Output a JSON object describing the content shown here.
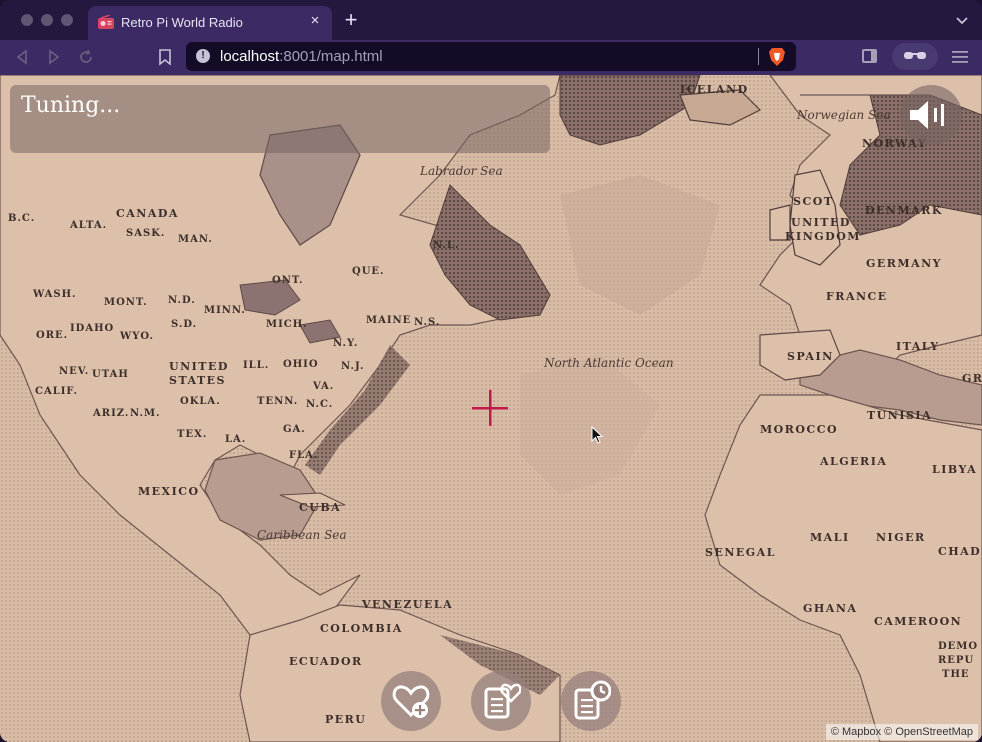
{
  "browser": {
    "tab": {
      "title": "Retro Pi World Radio",
      "favicon": "radio-icon",
      "close_glyph": "×"
    },
    "new_tab_glyph": "+",
    "url": {
      "host": "localhost",
      "rest": ":8001/map.html"
    }
  },
  "app": {
    "status": "Tuning...",
    "attribution": "© Mapbox © OpenStreetMap",
    "buttons": [
      {
        "name": "add-favorite-button",
        "icon": "heart-plus-icon"
      },
      {
        "name": "favorites-list-button",
        "icon": "heart-list-icon"
      },
      {
        "name": "history-button",
        "icon": "clock-list-icon"
      }
    ],
    "volume_icon": "speaker-icon",
    "accent_color": "#c2174b"
  },
  "map_labels": {
    "iceland": "ICELAND",
    "norwegian_sea": "Norwegian Sea",
    "labrador_sea": "Labrador Sea",
    "norway": "NORWAY",
    "scot": "SCOT",
    "denmark": "DENMARK",
    "uk1": "UNITED",
    "uk2": "KINGDOM",
    "germany": "GERMANY",
    "france": "FRANCE",
    "canada": "CANADA",
    "bc": "B.C.",
    "alta": "ALTA.",
    "sask": "SASK.",
    "man": "MAN.",
    "nl": "N.L.",
    "que": "QUE.",
    "ont": "ONT.",
    "wash": "WASH.",
    "mont": "MONT.",
    "nd": "N.D.",
    "minn": "MINN.",
    "maine": "MAINE",
    "ns": "N.S.",
    "ore": "ORE.",
    "idaho": "IDAHO",
    "wyo": "WYO.",
    "sd": "S.D.",
    "mich": "MICH.",
    "ny": "N.Y.",
    "spain": "SPAIN",
    "italy": "ITALY",
    "gr": "GR",
    "north_atlantic": "North Atlantic Ocean",
    "us1": "UNITED",
    "us2": "STATES",
    "nev": "NEV.",
    "utah": "UTAH",
    "ill": "ILL.",
    "ohio": "OHIO",
    "va": "VA.",
    "nj": "N.J.",
    "calif": "CALIF.",
    "okla": "OKLA.",
    "tenn": "TENN.",
    "nc": "N.C.",
    "ariz": "ARIZ.",
    "nm": "N.M.",
    "tunisia": "TUNISIA",
    "tex": "TEX.",
    "la": "LA.",
    "ga": "GA.",
    "morocco": "MOROCCO",
    "fla": "FLA.",
    "algeria": "ALGERIA",
    "libya": "LIBYA",
    "mexico": "MEXICO",
    "cuba": "CUBA",
    "caribbean": "Caribbean Sea",
    "senegal": "SENEGAL",
    "mali": "MALI",
    "niger": "NIGER",
    "chad": "CHAD",
    "venezuela": "VENEZUELA",
    "ghana": "GHANA",
    "colombia": "COLOMBIA",
    "cameroon": "CAMEROON",
    "ecuador": "ECUADOR",
    "demo": "DEMO",
    "repu": "REPU",
    "the": "THE",
    "peru": "PERU"
  }
}
